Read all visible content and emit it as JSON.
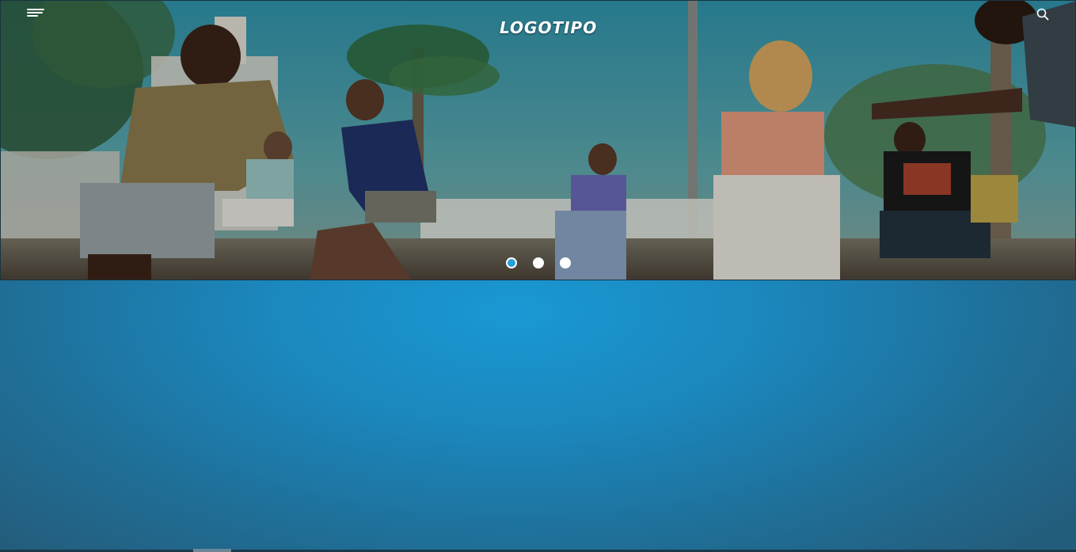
{
  "header": {
    "logo_text": "LOGOTIPO",
    "menu_icon": "hamburger-menu-icon",
    "search_icon": "search-icon"
  },
  "hero": {
    "image_description_icon": "hero-photo",
    "carousel": {
      "slide_count": 3,
      "active_index": 0
    }
  },
  "colors": {
    "accent": "#2a9fd8",
    "band": "#1b87bd"
  }
}
